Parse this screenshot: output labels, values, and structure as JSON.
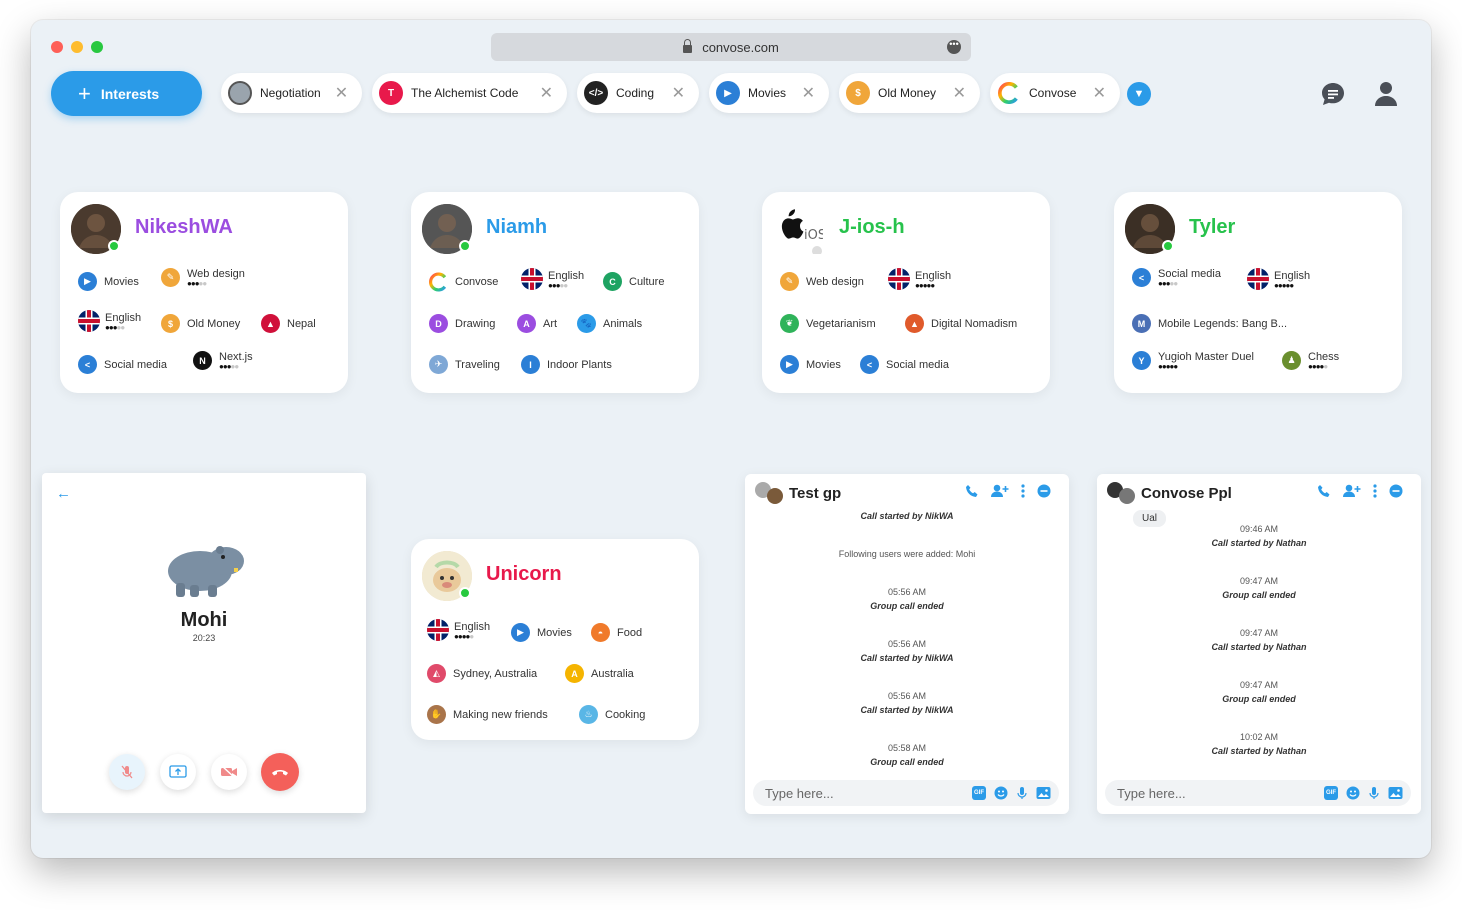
{
  "browser": {
    "url": "convose.com"
  },
  "header": {
    "interests_label": "Interests",
    "chips": [
      {
        "label": "Negotiation",
        "icon": "negotiation-icon",
        "color": "#9aa4ad",
        "letter": ""
      },
      {
        "label": "The Alchemist Code",
        "icon": "letter-avatar",
        "color": "#e8194b",
        "letter": "T"
      },
      {
        "label": "Coding",
        "icon": "code-icon",
        "color": "#222222",
        "letter": "</>"
      },
      {
        "label": "Movies",
        "icon": "play-icon",
        "color": "#2b7fd6",
        "letter": "▶"
      },
      {
        "label": "Old Money",
        "icon": "money-icon",
        "color": "#f0a63a",
        "letter": "$"
      },
      {
        "label": "Convose",
        "icon": "convose-logo-icon",
        "color": "#ffffff",
        "letter": ""
      }
    ]
  },
  "cards": [
    {
      "name": "NikeshWA",
      "name_color": "#9b4de0",
      "avatar_color": "#4a3a2e",
      "online": true,
      "tags": [
        {
          "label": "Movies",
          "icon": "play-icon",
          "color": "#2b7fd6",
          "letter": "▶"
        },
        {
          "label": "Web design",
          "icon": "pen-icon",
          "color": "#f0a63a",
          "letter": "✎",
          "level": 3
        },
        {
          "label": "English",
          "icon": "uk-flag-icon",
          "flag": true,
          "level": 3
        },
        {
          "label": "Old Money",
          "icon": "money-icon",
          "color": "#f0a63a",
          "letter": "$"
        },
        {
          "label": "Nepal",
          "icon": "nepal-flag-icon",
          "color": "#d0103a",
          "letter": "▲"
        },
        {
          "label": "Social media",
          "icon": "share-icon",
          "color": "#2b7fd6",
          "letter": "<"
        },
        {
          "label": "Next.js",
          "icon": "nextjs-icon",
          "color": "#111111",
          "letter": "N",
          "level": 3
        }
      ]
    },
    {
      "name": "Niamh",
      "name_color": "#2b9be8",
      "avatar_color": "#555555",
      "online": true,
      "tags": [
        {
          "label": "Convose",
          "icon": "convose-logo-icon",
          "color": "#ffffff",
          "letter": ""
        },
        {
          "label": "English",
          "icon": "uk-flag-icon",
          "flag": true,
          "level": 3
        },
        {
          "label": "Culture",
          "icon": "letter-avatar",
          "color": "#1ea362",
          "letter": "C"
        },
        {
          "label": "Drawing",
          "icon": "letter-avatar",
          "color": "#9b4de0",
          "letter": "D"
        },
        {
          "label": "Art",
          "icon": "letter-avatar",
          "color": "#9b4de0",
          "letter": "A"
        },
        {
          "label": "Animals",
          "icon": "paw-icon",
          "color": "#2b9be8",
          "letter": "🐾"
        },
        {
          "label": "Traveling",
          "icon": "airplane-icon",
          "color": "#7fa8d6",
          "letter": "✈"
        },
        {
          "label": "Indoor Plants",
          "icon": "letter-avatar",
          "color": "#2b7fd6",
          "letter": "I"
        }
      ]
    },
    {
      "name": "J-ios-h",
      "name_color": "#27c24c",
      "avatar_color": "#ffffff",
      "online": false,
      "tags": [
        {
          "label": "Web design",
          "icon": "pen-icon",
          "color": "#f0a63a",
          "letter": "✎"
        },
        {
          "label": "English",
          "icon": "uk-flag-icon",
          "flag": true,
          "level": 5
        },
        {
          "label": "Vegetarianism",
          "icon": "leaf-icon",
          "color": "#2fb35a",
          "letter": "❦"
        },
        {
          "label": "Digital Nomadism",
          "icon": "tent-icon",
          "color": "#e05a2b",
          "letter": "▲"
        },
        {
          "label": "Movies",
          "icon": "play-icon",
          "color": "#2b7fd6",
          "letter": "▶"
        },
        {
          "label": "Social media",
          "icon": "share-icon",
          "color": "#2b7fd6",
          "letter": "<"
        }
      ]
    },
    {
      "name": "Tyler",
      "name_color": "#27c24c",
      "avatar_color": "#3b2f25",
      "online": true,
      "tags": [
        {
          "label": "Social media",
          "icon": "share-icon",
          "color": "#2b7fd6",
          "letter": "<",
          "level": 3
        },
        {
          "label": "English",
          "icon": "uk-flag-icon",
          "flag": true,
          "level": 5
        },
        {
          "label": "Mobile Legends: Bang B...",
          "icon": "game-icon",
          "color": "#4a6fb5",
          "letter": "M"
        },
        {
          "label": "Yugioh Master Duel",
          "icon": "letter-avatar",
          "color": "#2b7fd6",
          "letter": "Y",
          "level": 5
        },
        {
          "label": "Chess",
          "icon": "chess-pawn-icon",
          "color": "#6a8f2e",
          "letter": "♟",
          "level": 4
        }
      ]
    },
    {
      "name": "Unicorn",
      "name_color": "#e8194b",
      "avatar_color": "#e6d8b8",
      "online": true,
      "tags": [
        {
          "label": "English",
          "icon": "uk-flag-icon",
          "flag": true,
          "level": 4
        },
        {
          "label": "Movies",
          "icon": "play-icon",
          "color": "#2b7fd6",
          "letter": "▶"
        },
        {
          "label": "Food",
          "icon": "cloche-icon",
          "color": "#f07a2b",
          "letter": "◓"
        },
        {
          "label": "Sydney, Australia",
          "icon": "opera-house-icon",
          "color": "#e04a6a",
          "letter": "◭"
        },
        {
          "label": "Australia",
          "icon": "letter-avatar",
          "color": "#f5b400",
          "letter": "A"
        },
        {
          "label": "Making new friends",
          "icon": "handshake-icon",
          "color": "#a9744a",
          "letter": "✋"
        },
        {
          "label": "Cooking",
          "icon": "chef-hat-icon",
          "color": "#59b6e6",
          "letter": "♨"
        }
      ]
    }
  ],
  "call": {
    "name": "Mohi",
    "time": "20:23"
  },
  "chats": [
    {
      "title": "Test gp",
      "placeholder": "Type here...",
      "messages": [
        {
          "text": "Call started by NikWA",
          "type": "ev"
        },
        {
          "text": "Following users were added: Mohi",
          "type": "sys"
        },
        {
          "text": "05:56 AM",
          "type": "time"
        },
        {
          "text": "Group call ended",
          "type": "ev"
        },
        {
          "text": "05:56 AM",
          "type": "time"
        },
        {
          "text": "Call started by NikWA",
          "type": "ev"
        },
        {
          "text": "05:56 AM",
          "type": "time"
        },
        {
          "text": "Call started by NikWA",
          "type": "ev"
        },
        {
          "text": "05:58 AM",
          "type": "time"
        },
        {
          "text": "Group call ended",
          "type": "ev"
        }
      ]
    },
    {
      "title": "Convose Ppl",
      "placeholder": "Type here...",
      "bubble": "Ual",
      "messages": [
        {
          "text": "09:46 AM",
          "type": "time"
        },
        {
          "text": "Call started by Nathan",
          "type": "ev"
        },
        {
          "text": "09:47 AM",
          "type": "time"
        },
        {
          "text": "Group call ended",
          "type": "ev"
        },
        {
          "text": "09:47 AM",
          "type": "time"
        },
        {
          "text": "Call started by Nathan",
          "type": "ev"
        },
        {
          "text": "09:47 AM",
          "type": "time"
        },
        {
          "text": "Group call ended",
          "type": "ev"
        },
        {
          "text": "10:02 AM",
          "type": "time"
        },
        {
          "text": "Call started by Nathan",
          "type": "ev"
        }
      ]
    }
  ]
}
